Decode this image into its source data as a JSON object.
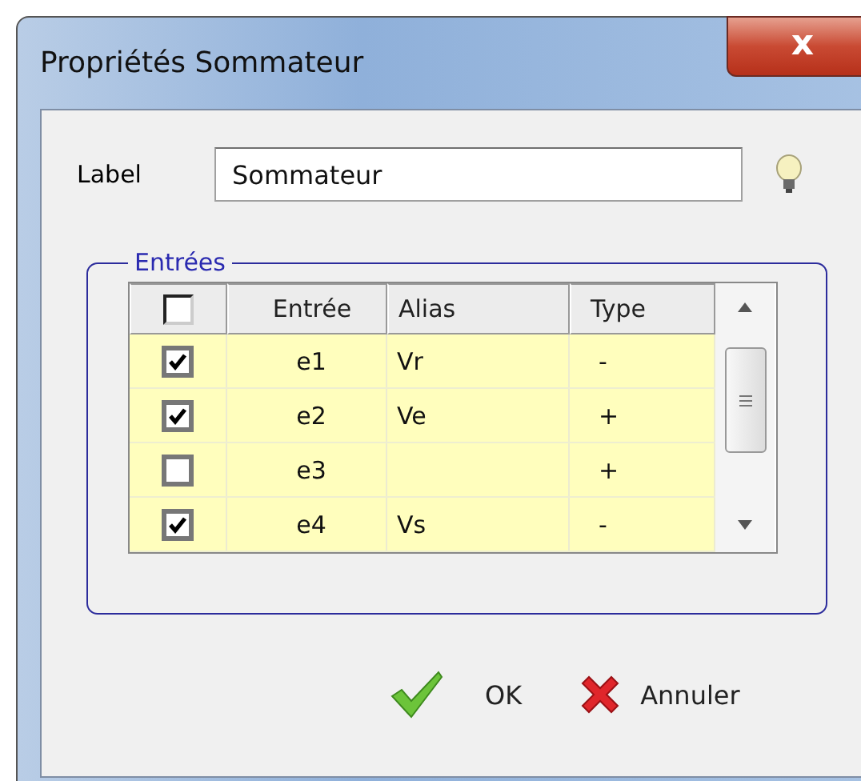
{
  "window": {
    "title": "Propriétés Sommateur",
    "close": "x"
  },
  "label_field": {
    "label": "Label",
    "value": "Sommateur"
  },
  "group": {
    "title": "Entrées"
  },
  "table": {
    "header_checkbox": {
      "checked": false
    },
    "columns": [
      "Entrée",
      "Alias",
      "Type"
    ],
    "rows": [
      {
        "checked": true,
        "input": "e1",
        "alias": "Vr",
        "type": "-"
      },
      {
        "checked": true,
        "input": "e2",
        "alias": "Ve",
        "type": "+"
      },
      {
        "checked": false,
        "input": "e3",
        "type": "+"
      },
      {
        "checked": true,
        "input": "e4",
        "alias": "Vs",
        "type": "-"
      }
    ]
  },
  "buttons": [
    {
      "kind": "ok",
      "label": "OK"
    },
    {
      "kind": "cancel",
      "label": "Annuler"
    }
  ]
}
